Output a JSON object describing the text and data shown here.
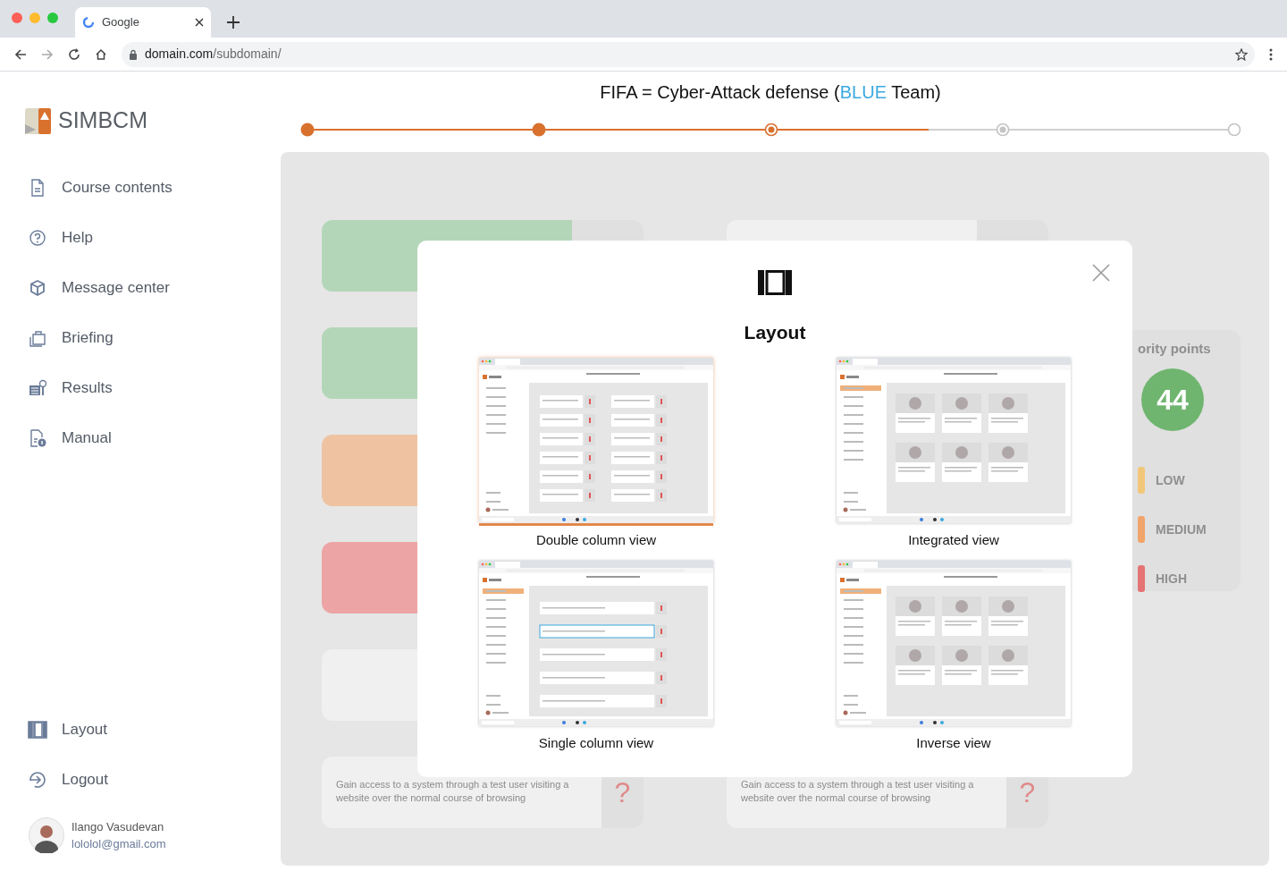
{
  "browser": {
    "tab_title": "Google",
    "url_host": "domain.com",
    "url_path": "/subdomain/"
  },
  "brand": "SIMBCM",
  "sidebar": {
    "items": [
      {
        "label": "Course contents"
      },
      {
        "label": "Help"
      },
      {
        "label": "Message center"
      },
      {
        "label": "Briefing"
      },
      {
        "label": "Results"
      },
      {
        "label": "Manual"
      }
    ],
    "bottom_items": [
      {
        "label": "Layout"
      },
      {
        "label": "Logout"
      }
    ],
    "user": {
      "name": "Ilango Vasudevan",
      "email": "lololol@gmail.com"
    }
  },
  "title": [
    {
      "text": "FIFA = Cyber-Attack defense (",
      "kind": "plain"
    },
    {
      "text": "BLUE",
      "kind": "accent"
    },
    {
      "text": " Team)",
      "kind": "plain"
    }
  ],
  "stepper": {
    "progress": {
      "level": 0.67
    },
    "steps": [
      {
        "kind": "done"
      },
      {
        "kind": "done"
      },
      {
        "kind": "current"
      },
      {
        "kind": "pending"
      },
      {
        "kind": "empty"
      }
    ]
  },
  "background": {
    "bottom_cards": [
      {
        "text": "Gain access to a system through a test user visiting a website over the normal course of browsing",
        "mark": "?"
      },
      {
        "text": "Gain access to a system through a test user visiting a website over the normal course of browsing",
        "mark": "?"
      }
    ],
    "priority": {
      "title": "ority points",
      "points": "44",
      "legend": [
        {
          "label": "LOW",
          "color": "#f3c77a"
        },
        {
          "label": "MEDIUM",
          "color": "#f1a56b"
        },
        {
          "label": "HIGH",
          "color": "#e57373"
        }
      ]
    }
  },
  "modal": {
    "title": "Layout",
    "options": [
      {
        "label": "Double column view",
        "kind": "double",
        "selected": true
      },
      {
        "label": "Integrated view",
        "kind": "integrated",
        "selected": false
      },
      {
        "label": "Single column view",
        "kind": "single",
        "selected": false
      },
      {
        "label": "Inverse view",
        "kind": "inverse",
        "selected": false
      }
    ]
  }
}
